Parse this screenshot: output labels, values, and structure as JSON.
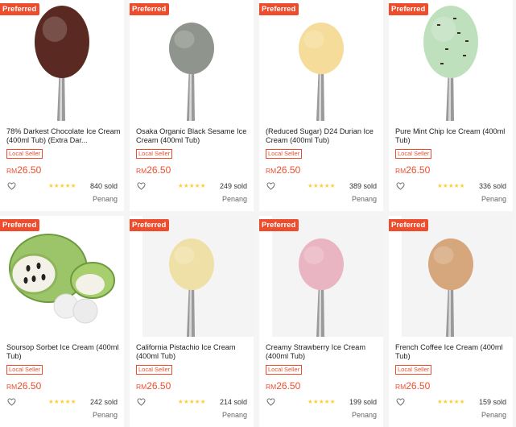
{
  "products": [
    {
      "badge": "Preferred",
      "title": "78% Darkest Chocolate Ice Cream (400ml Tub) (Extra Dar...",
      "tag": "Local Seller",
      "currency": "RM",
      "price": "26.50",
      "rating_stars": "★★★★★",
      "sold": "840 sold",
      "location": "Penang",
      "flavor": "darkest-chocolate",
      "scoop_color": "#5a2a22"
    },
    {
      "badge": "Preferred",
      "title": "Osaka Organic Black Sesame Ice Cream (400ml Tub)",
      "tag": "Local Seller",
      "currency": "RM",
      "price": "26.50",
      "rating_stars": "★★★★★",
      "sold": "249 sold",
      "location": "Penang",
      "flavor": "black-sesame",
      "scoop_color": "#8f948c"
    },
    {
      "badge": "Preferred",
      "title": "(Reduced Sugar) D24 Durian Ice Cream (400ml Tub)",
      "tag": "Local Seller",
      "currency": "RM",
      "price": "26.50",
      "rating_stars": "★★★★★",
      "sold": "389 sold",
      "location": "Penang",
      "flavor": "durian",
      "scoop_color": "#f6dc9a"
    },
    {
      "badge": "Preferred",
      "title": "Pure Mint Chip Ice Cream (400ml Tub)",
      "tag": "Local Seller",
      "currency": "RM",
      "price": "26.50",
      "rating_stars": "★★★★★",
      "sold": "336 sold",
      "location": "Penang",
      "flavor": "mint-chip",
      "scoop_color": "#bfe0bd"
    },
    {
      "badge": "Preferred",
      "title": "Soursop Sorbet Ice Cream (400ml Tub)",
      "tag": "Local Seller",
      "currency": "RM",
      "price": "26.50",
      "rating_stars": "★★★★★",
      "sold": "242 sold",
      "location": "Penang",
      "flavor": "soursop",
      "scoop_color": "#9cc56a"
    },
    {
      "badge": "Preferred",
      "title": "California Pistachio Ice Cream (400ml Tub)",
      "tag": "Local Seller",
      "currency": "RM",
      "price": "26.50",
      "rating_stars": "★★★★★",
      "sold": "214 sold",
      "location": "Penang",
      "flavor": "pistachio",
      "scoop_color": "#efe0a7"
    },
    {
      "badge": "Preferred",
      "title": "Creamy Strawberry Ice Cream (400ml Tub)",
      "tag": "Local Seller",
      "currency": "RM",
      "price": "26.50",
      "rating_stars": "★★★★★",
      "sold": "199 sold",
      "location": "Penang",
      "flavor": "strawberry",
      "scoop_color": "#eab5c3"
    },
    {
      "badge": "Preferred",
      "title": "French Coffee Ice Cream (400ml Tub)",
      "tag": "Local Seller",
      "currency": "RM",
      "price": "26.50",
      "rating_stars": "★★★★★",
      "sold": "159 sold",
      "location": "Penang",
      "flavor": "french-coffee",
      "scoop_color": "#d6a67c"
    }
  ],
  "colors": {
    "accent": "#ee4d2d",
    "star": "#ffce3d",
    "background": "#f5f5f5"
  }
}
